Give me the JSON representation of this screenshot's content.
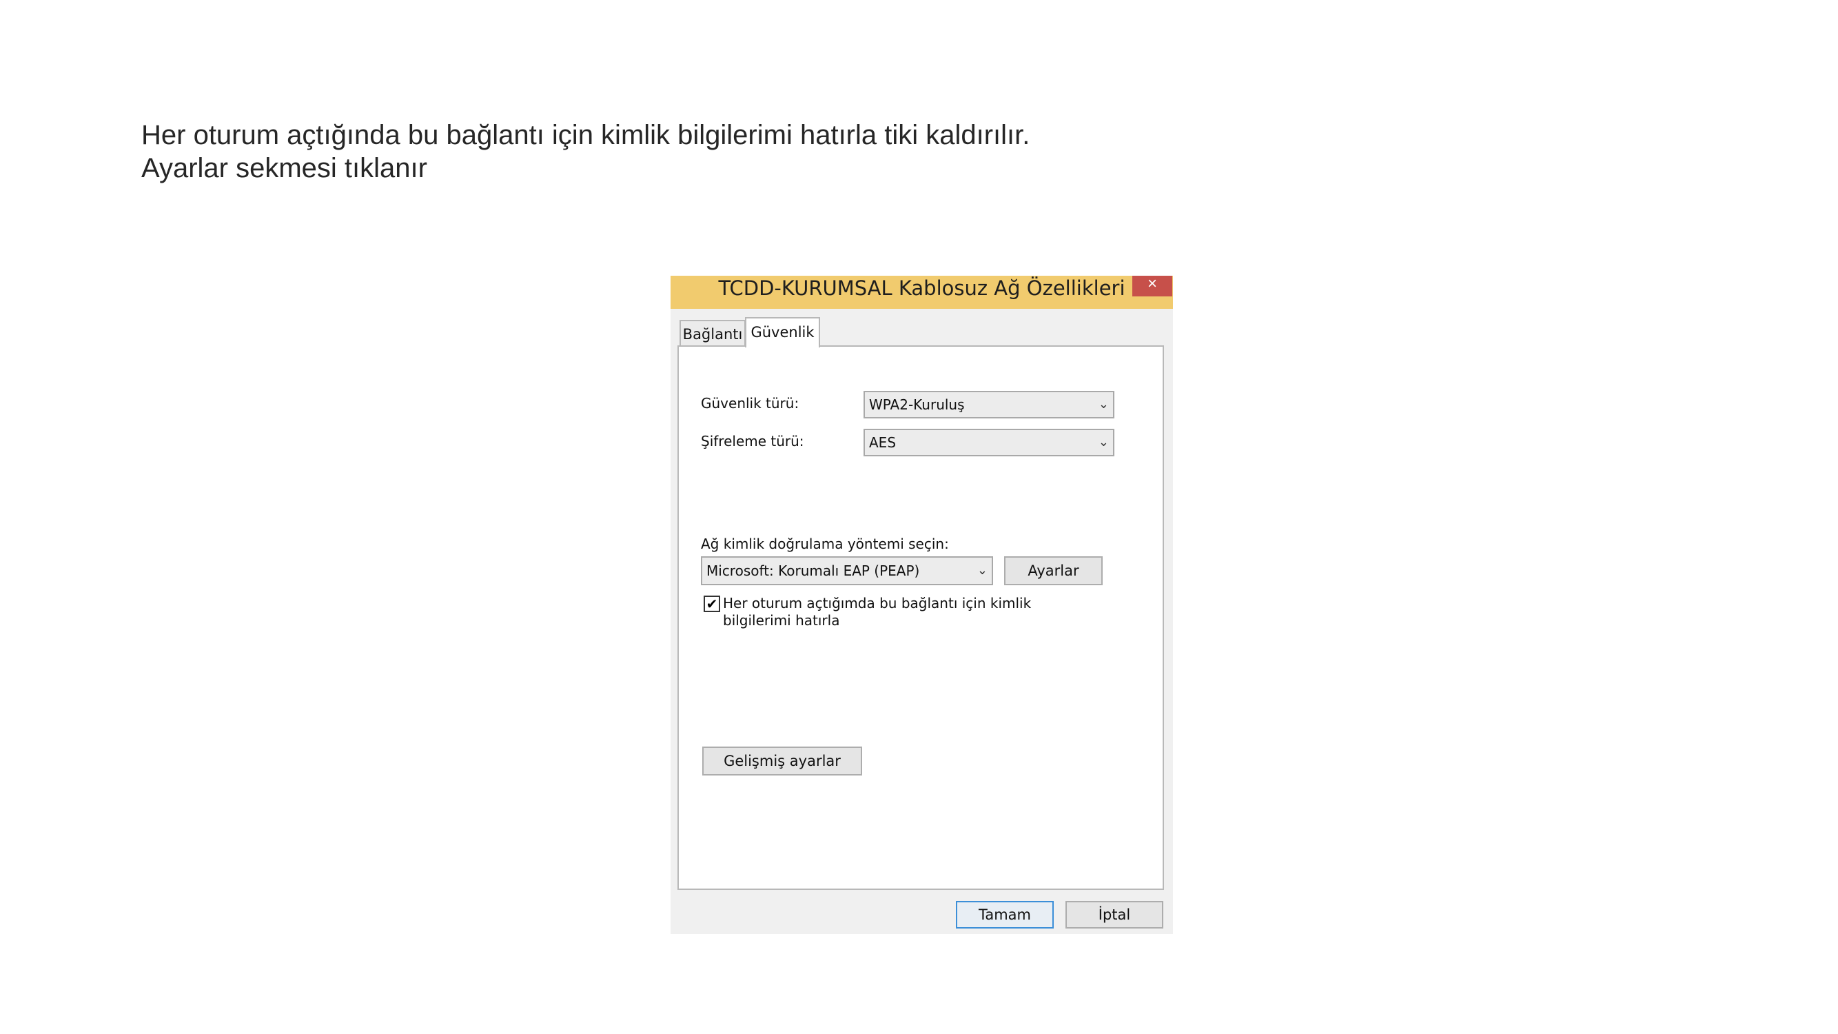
{
  "slide": {
    "line1": "Her oturum açtığında bu bağlantı için kimlik bilgilerimi hatırla tiki kaldırılır.",
    "line2": "Ayarlar sekmesi tıklanır"
  },
  "dialog": {
    "title": "TCDD-KURUMSAL Kablosuz Ağ Özellikleri",
    "close_glyph": "×",
    "tabs": [
      {
        "label": "Bağlantı",
        "active": false
      },
      {
        "label": "Güvenlik",
        "active": true
      }
    ],
    "security_type": {
      "label": "Güvenlik türü:",
      "value": "WPA2-Kuruluş"
    },
    "encryption_type": {
      "label": "Şifreleme türü:",
      "value": "AES"
    },
    "auth_method": {
      "label": "Ağ kimlik doğrulama yöntemi seçin:",
      "value": "Microsoft: Korumalı EAP (PEAP)",
      "settings_button": "Ayarlar"
    },
    "remember_credentials": {
      "checked": true,
      "check_glyph": "✔",
      "label": "Her oturum açtığımda bu bağlantı için kimlik bilgilerimi hatırla"
    },
    "advanced_button": "Gelişmiş ayarlar",
    "ok_button": "Tamam",
    "cancel_button": "İptal",
    "chevron_glyph": "⌄"
  },
  "colors": {
    "titlebar": "#f1cb6e",
    "close_button": "#c7504a",
    "default_button_border": "#3c8fd8"
  },
  "icons": {
    "close": "close-icon",
    "dropdown": "chevron-down-icon",
    "checkbox": "checkmark-icon"
  }
}
